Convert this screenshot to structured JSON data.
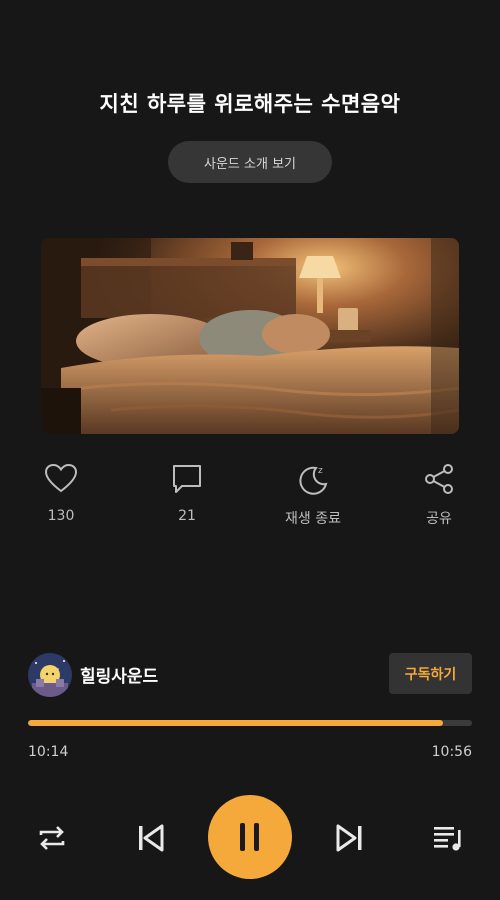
{
  "header": {
    "title": "지친 하루를 위로해주는 수면음악",
    "intro_button": "사운드 소개 보기"
  },
  "artwork": {
    "icon": "bedroom-image"
  },
  "actions": [
    {
      "icon": "heart-icon",
      "label": "130"
    },
    {
      "icon": "comment-icon",
      "label": "21"
    },
    {
      "icon": "moon-sleep-icon",
      "label": "재생 종료"
    },
    {
      "icon": "share-icon",
      "label": "공유"
    }
  ],
  "channel": {
    "name": "힐링사운드",
    "subscribe_label": "구독하기"
  },
  "player": {
    "elapsed": "10:14",
    "total": "10:56",
    "progress": 0.935,
    "accent": "#f5a93a"
  },
  "controls": {
    "repeat": "repeat-icon",
    "previous": "skip-previous-icon",
    "pause": "pause-icon",
    "next": "skip-next-icon",
    "playlist": "playlist-icon"
  }
}
